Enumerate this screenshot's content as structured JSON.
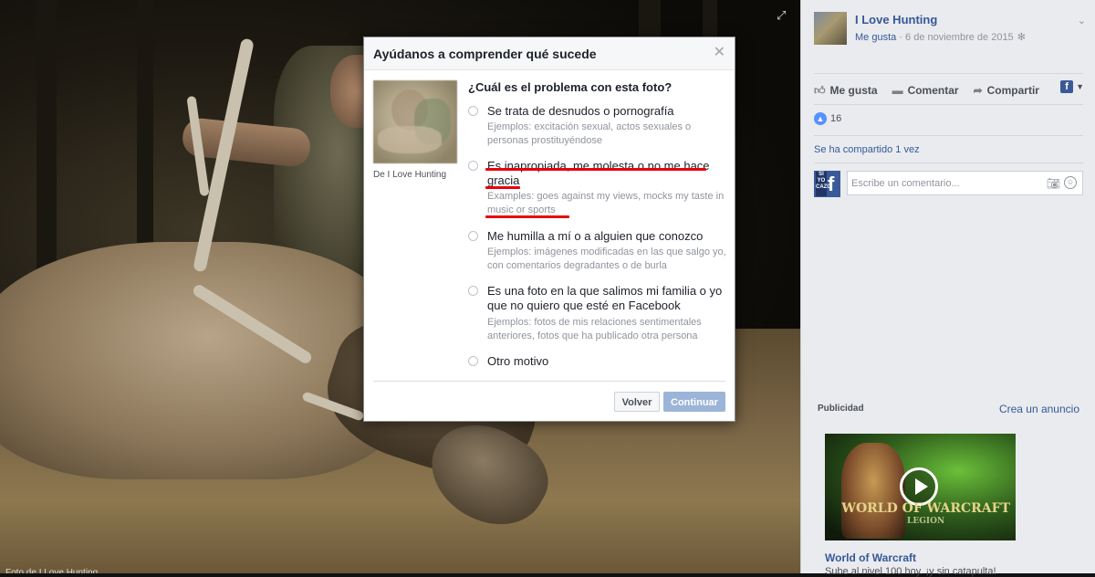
{
  "photo": {
    "caption": "Foto de I Love Hunting"
  },
  "sidebar": {
    "page_name": "I Love Hunting",
    "like_link": "Me gusta",
    "separator": " · ",
    "date": "6 de noviembre de 2015",
    "actions": {
      "like": "Me gusta",
      "comment": "Comentar",
      "share": "Compartir"
    },
    "reactions_count": "16",
    "shared": "Se ha compartido 1 vez",
    "comment_placeholder": "Escribe un comentario...",
    "commenter_avatar_text": "SI YO CAZO",
    "ads": {
      "title": "Publicidad",
      "create": "Crea un anuncio",
      "logo_text": "WORLD OF WARCRAFT",
      "logo_sub": "LEGION",
      "ad_title": "World of Warcraft",
      "ad_desc": "Sube al nivel 100 hoy. ¡y sin catapulta!"
    }
  },
  "modal": {
    "title": "Ayúdanos a comprender qué sucede",
    "thumb_caption": "De I Love Hunting",
    "question": "¿Cuál es el problema con esta foto?",
    "options": [
      {
        "label": "Se trata de desnudos o pornografía",
        "example": "Ejemplos: excitación sexual, actos sexuales o personas prostituyéndose"
      },
      {
        "label": "Es inapropiada, me molesta o no me hace gracia",
        "example": "Examples: goes against my views, mocks my taste in music or sports"
      },
      {
        "label": "Me humilla a mí o a alguien que conozco",
        "example": "Ejemplos: imágenes modificadas en las que salgo yo, con comentarios degradantes o de burla"
      },
      {
        "label": "Es una foto en la que salimos mi familia o yo que no quiero que esté en Facebook",
        "example": "Ejemplos: fotos de mis relaciones sentimentales anteriores, fotos que ha publicado otra persona"
      },
      {
        "label": "Otro motivo",
        "example": ""
      }
    ],
    "back": "Volver",
    "continue": "Continuar"
  }
}
